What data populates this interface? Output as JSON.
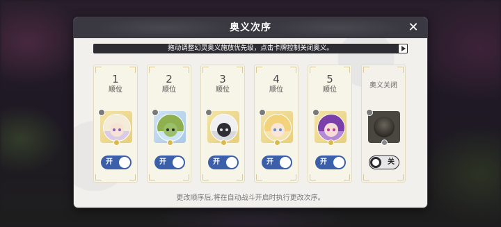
{
  "dialog": {
    "title": "奥义次序",
    "notice": "拖动调整幻灵奥义施放优先级，点击卡牌控制关闭奥义。",
    "footer": "更改顺序后,将在自动战斗开启时执行更改次序。"
  },
  "slots": [
    {
      "rank": "1",
      "rank_label": "顺位",
      "toggle_label": "开",
      "enabled": true,
      "portrait": "character-portrait-silver-hair"
    },
    {
      "rank": "2",
      "rank_label": "顺位",
      "toggle_label": "开",
      "enabled": true,
      "portrait": "character-portrait-green-goblin"
    },
    {
      "rank": "3",
      "rank_label": "顺位",
      "toggle_label": "开",
      "enabled": true,
      "portrait": "character-portrait-white-hair-mask"
    },
    {
      "rank": "4",
      "rank_label": "顺位",
      "toggle_label": "开",
      "enabled": true,
      "portrait": "character-portrait-blonde"
    },
    {
      "rank": "5",
      "rank_label": "顺位",
      "toggle_label": "开",
      "enabled": true,
      "portrait": "character-portrait-purple-hair"
    }
  ],
  "closed_slot": {
    "label": "奥义关闭",
    "toggle_label": "关",
    "enabled": false
  },
  "colors": {
    "toggle_on": "#3b5fa8",
    "header": "#3a3840",
    "panel": "#f1f0ec",
    "card": "#f7f4e8",
    "portrait_frame": "#e8cf7c"
  },
  "icons": {
    "close": "close-icon",
    "play": "play-icon",
    "element": "element-icon",
    "coin": "coin-icon"
  }
}
